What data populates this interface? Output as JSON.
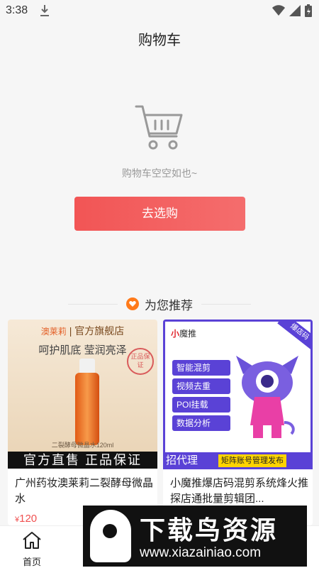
{
  "status_bar": {
    "time": "3:38"
  },
  "header": {
    "title": "购物车"
  },
  "empty_cart": {
    "message": "购物车空空如也~",
    "button_label": "去选购"
  },
  "recommend": {
    "title": "为您推荐"
  },
  "products": [
    {
      "title": "广州药妆澳莱莉二裂酵母微晶水",
      "price": "120",
      "price_symbol": "¥",
      "image": {
        "brand": "澳莱莉",
        "brand_suffix": "官方旗舰店",
        "logo_text": "aolaily",
        "slogan": "呵护肌底 莹润亮泽",
        "seal": "正品保证",
        "caption": "二裂酵母微晶水120ml",
        "bottom": "官方直售 正品保证"
      }
    },
    {
      "title": "小魔推爆店码混剪系统烽火推探店通批量剪辑团...",
      "image": {
        "logo_prefix": "小",
        "logo_rest": "魔推",
        "corner": "爆店码",
        "features": [
          "智能混剪",
          "视频去重",
          "POI挂载",
          "数据分析"
        ],
        "bottom_left": "招代理",
        "bottom_right": "矩阵账号管理发布"
      }
    }
  ],
  "tabbar": {
    "home_label": "首页"
  },
  "watermark": {
    "title": "下载鸟资源",
    "url": "www.xiazainiao.com"
  },
  "colors": {
    "accent": "#f25555",
    "purple": "#5a42d6",
    "heart": "#ff7a1a"
  }
}
